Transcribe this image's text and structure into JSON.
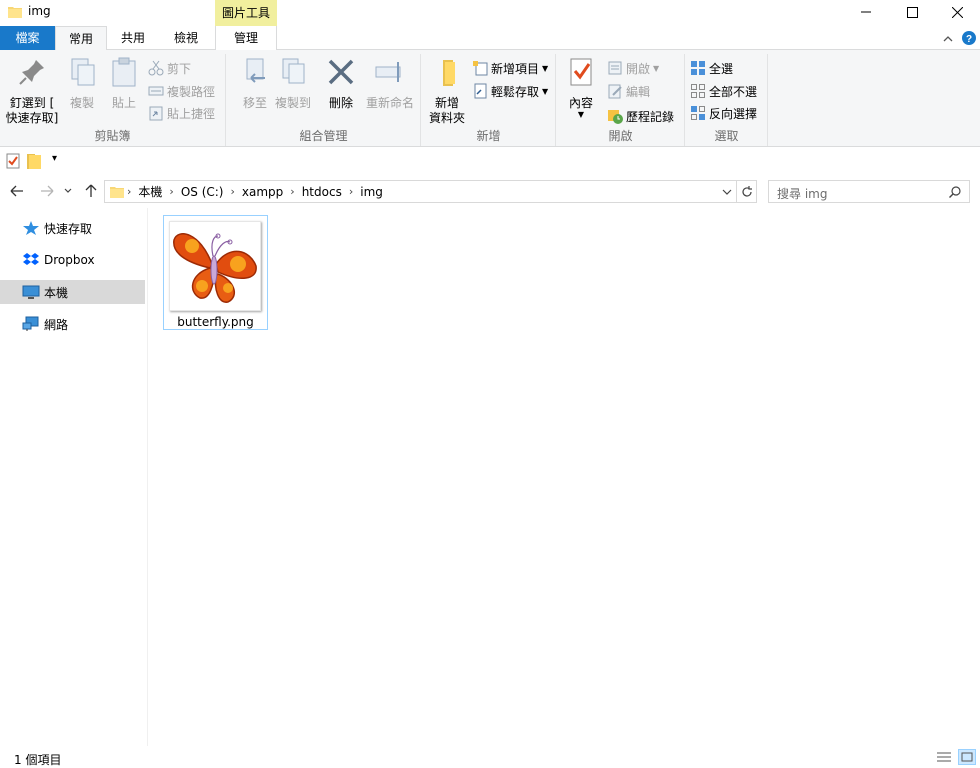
{
  "window": {
    "title": "img",
    "context_tab_group": "圖片工具"
  },
  "tabs": [
    {
      "label": "檔案"
    },
    {
      "label": "常用"
    },
    {
      "label": "共用"
    },
    {
      "label": "檢視"
    },
    {
      "label": "管理"
    }
  ],
  "ribbon": {
    "clipboard": {
      "label": "剪貼簿",
      "pin_line1": "釘選到 [",
      "pin_line2": "快速存取]",
      "copy": "複製",
      "paste": "貼上",
      "cut": "剪下",
      "copy_path": "複製路徑",
      "paste_shortcut": "貼上捷徑"
    },
    "organize": {
      "label": "組合管理",
      "move_to": "移至",
      "copy_to": "複製到",
      "delete": "刪除",
      "rename": "重新命名"
    },
    "new": {
      "label": "新增",
      "new_folder_line1": "新增",
      "new_folder_line2": "資料夾",
      "new_item": "新增項目",
      "easy_access": "輕鬆存取"
    },
    "open": {
      "label": "開啟",
      "properties": "內容",
      "open": "開啟",
      "edit": "編輯",
      "history": "歷程記錄"
    },
    "select": {
      "label": "選取",
      "select_all": "全選",
      "select_none": "全部不選",
      "invert": "反向選擇"
    }
  },
  "address": {
    "crumbs": [
      "本機",
      "OS (C:)",
      "xampp",
      "htdocs",
      "img"
    ],
    "search_placeholder": "搜尋 img"
  },
  "nav": {
    "items": [
      {
        "label": "快速存取"
      },
      {
        "label": "Dropbox"
      },
      {
        "label": "本機"
      },
      {
        "label": "網路"
      }
    ]
  },
  "files": [
    {
      "name": "butterfly.png"
    }
  ],
  "status": {
    "text": "1 個項目"
  },
  "colors": {
    "file_tab": "#1979ca",
    "context_tab": "#f1ef9e",
    "selection": "#99d1ff"
  }
}
